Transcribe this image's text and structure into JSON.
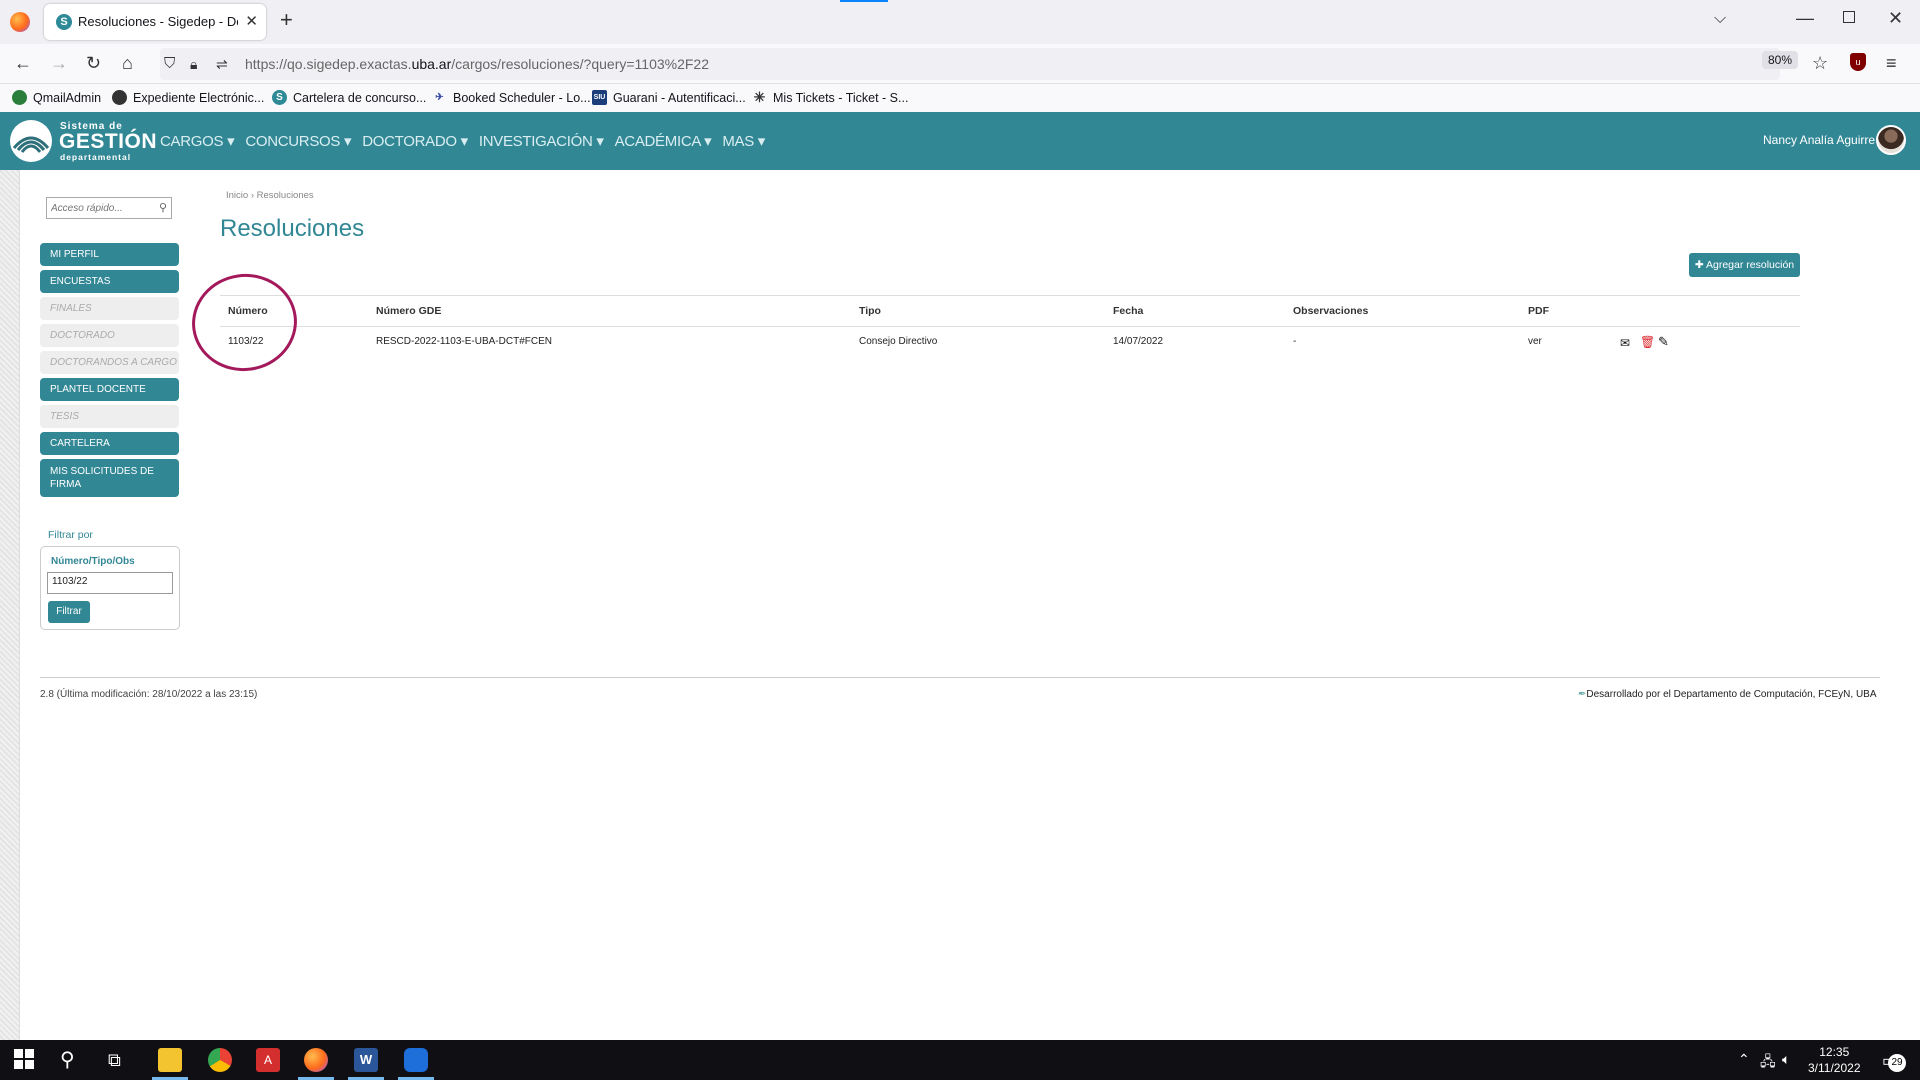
{
  "browser": {
    "tab_title": "Resoluciones - Sigedep - Depart",
    "tab_fav": "S",
    "url_prefix": "https://qo.sigedep.exactas.",
    "url_domain": "uba.ar",
    "url_suffix": "/cargos/resoluciones/?query=1103%2F22",
    "zoom": "80%",
    "bookmarks": [
      {
        "label": "QmailAdmin"
      },
      {
        "label": "Expediente Electrónic..."
      },
      {
        "label": "Cartelera de concurso..."
      },
      {
        "label": "Booked Scheduler - Lo..."
      },
      {
        "label": "Guarani - Autentificaci..."
      },
      {
        "label": "Mis Tickets - Ticket - S..."
      }
    ]
  },
  "app": {
    "logo_top": "Sistema de",
    "logo_main": "GESTIÓN",
    "logo_bottom": "departamental",
    "menu": [
      "CARGOS ▾",
      "CONCURSOS ▾",
      "DOCTORADO ▾",
      "INVESTIGACIÓN ▾",
      "ACADÉMICA ▾",
      "MAS ▾"
    ],
    "user_name": "Nancy Analía Aguirre"
  },
  "sidebar": {
    "search_placeholder": "Acceso rápido...",
    "items": [
      {
        "label": "MI PERFIL"
      },
      {
        "label": "ENCUESTAS"
      },
      {
        "label": "FINALES"
      },
      {
        "label": "DOCTORADO"
      },
      {
        "label": "DOCTORANDOS A CARGO"
      },
      {
        "label": "PLANTEL DOCENTE"
      },
      {
        "label": "TESIS"
      },
      {
        "label": "CARTELERA"
      },
      {
        "label": "MIS SOLICITUDES DE FIRMA"
      }
    ],
    "filter_title": "Filtrar por",
    "filter_label": "Número/Tipo/Obs",
    "filter_value": "1103/22",
    "filter_button": "Filtrar"
  },
  "main": {
    "breadcrumb": "Inicio › Resoluciones",
    "title": "Resoluciones",
    "add_button": "✚ Agregar resolución",
    "columns": [
      "Número",
      "Número GDE",
      "Tipo",
      "Fecha",
      "Observaciones",
      "PDF"
    ],
    "rows": [
      {
        "numero": "1103/22",
        "gde": "RESCD-2022-1103-E-UBA-DCT#FCEN",
        "tipo": "Consejo Directivo",
        "fecha": "14/07/2022",
        "obs": "-",
        "pdf": "ver"
      }
    ]
  },
  "footer": {
    "version": "2.8 (Última modificación: 28/10/2022 a las 23:15)",
    "credit": "Desarrollado por el Departamento de Computación, FCEyN, UBA"
  },
  "taskbar": {
    "time": "12:35",
    "date": "3/11/2022",
    "notifications": "29"
  }
}
